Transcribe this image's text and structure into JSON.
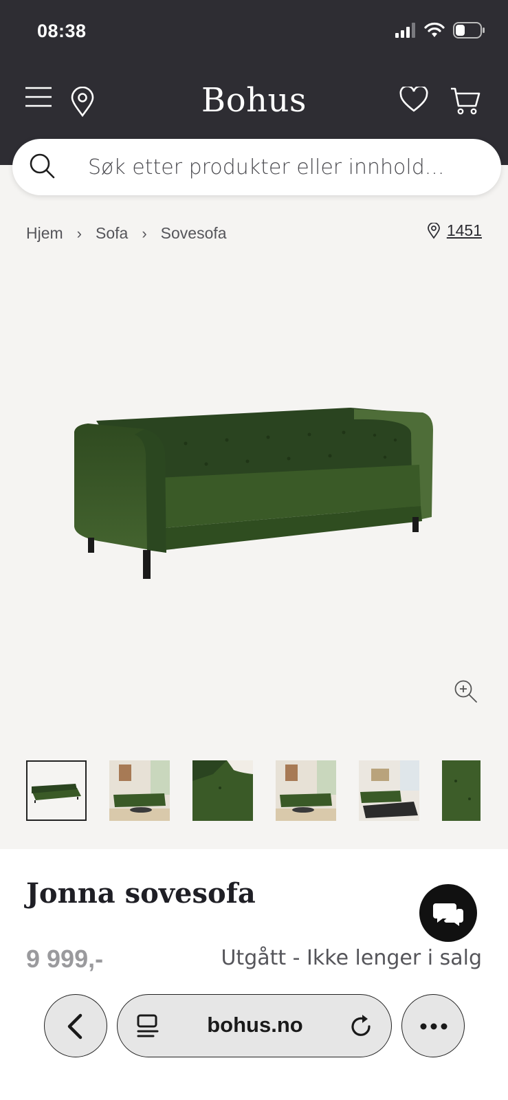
{
  "status_bar": {
    "time": "08:38"
  },
  "header": {
    "logo": "Bohus"
  },
  "search": {
    "placeholder": "Søk etter produkter eller innhold..."
  },
  "breadcrumb": {
    "items": [
      "Hjem",
      "Sofa",
      "Sovesofa"
    ]
  },
  "store": {
    "number": "1451"
  },
  "product": {
    "title": "Jonna sovesofa",
    "price": "9 999,-",
    "availability": "Utgått - Ikke lenger i salg",
    "color": "#3d5a2a"
  },
  "browser": {
    "url": "bohus.no"
  },
  "colors": {
    "header_bg": "#2e2d33",
    "page_bg": "#f5f4f2"
  }
}
